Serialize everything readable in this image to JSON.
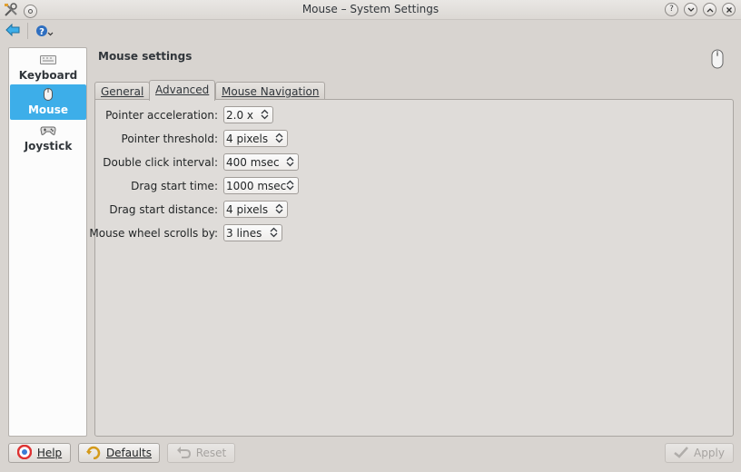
{
  "window": {
    "title": "Mouse – System Settings"
  },
  "sidebar": {
    "items": [
      {
        "label": "Keyboard",
        "icon": "keyboard-icon"
      },
      {
        "label": "Mouse",
        "icon": "mouse-icon",
        "selected": true
      },
      {
        "label": "Joystick",
        "icon": "gamepad-icon"
      }
    ]
  },
  "main": {
    "heading": "Mouse settings",
    "tabs": [
      {
        "label": "General"
      },
      {
        "label": "Advanced",
        "selected": true
      },
      {
        "label": "Mouse Navigation"
      }
    ],
    "fields": [
      {
        "label": "Pointer acceleration:",
        "value": "2.0 x"
      },
      {
        "label": "Pointer threshold:",
        "value": "4 pixels"
      },
      {
        "label": "Double click interval:",
        "value": "400 msec"
      },
      {
        "label": "Drag start time:",
        "value": "1000 msec"
      },
      {
        "label": "Drag start distance:",
        "value": "4 pixels"
      },
      {
        "label": "Mouse wheel scrolls by:",
        "value": "3 lines"
      }
    ]
  },
  "buttons": {
    "help": "Help",
    "defaults": "Defaults",
    "reset": "Reset",
    "apply": "Apply"
  },
  "colors": {
    "selection": "#3daee9",
    "window_bg": "#d8d4d0",
    "panel_bg": "#dfdcd9"
  }
}
